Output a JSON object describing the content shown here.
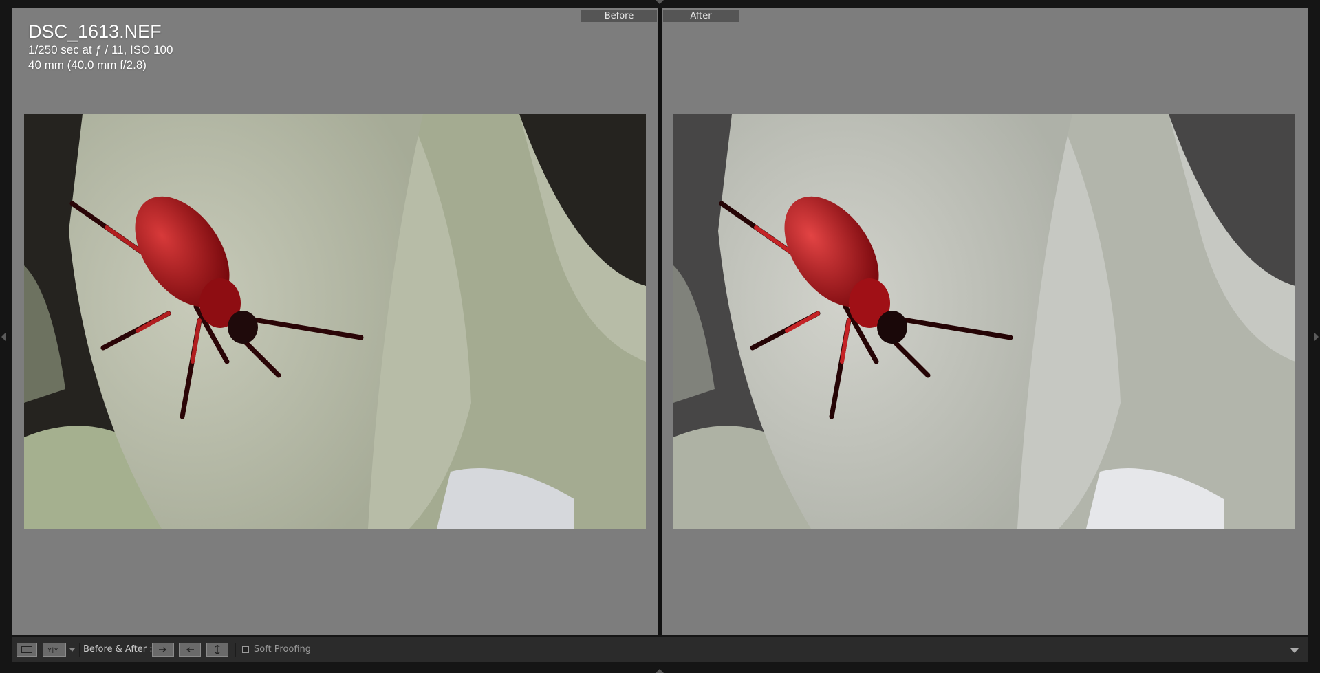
{
  "photo_info": {
    "filename": "DSC_1613.NEF",
    "exposure": "1/250 sec at ƒ / 11, ISO 100",
    "lens": "40 mm (40.0 mm f/2.8)"
  },
  "panes": {
    "before_label": "Before",
    "after_label": "After"
  },
  "toolbar": {
    "view_mode_label": "Before & After :",
    "soft_proofing_label": "Soft Proofing",
    "soft_proofing_checked": false,
    "icons": {
      "loupe": "loupe-view-icon",
      "before_after": "before-after-yy-icon",
      "copy_before_to_after": "copy-settings-right-icon",
      "copy_after_to_before": "copy-settings-left-icon",
      "swap": "swap-settings-icon",
      "menu": "toolbar-menu-icon"
    }
  },
  "colors": {
    "pane_background": "#7d7d7d",
    "toolbar_background": "#2b2b2b",
    "beetle_red": "#b0151a"
  }
}
